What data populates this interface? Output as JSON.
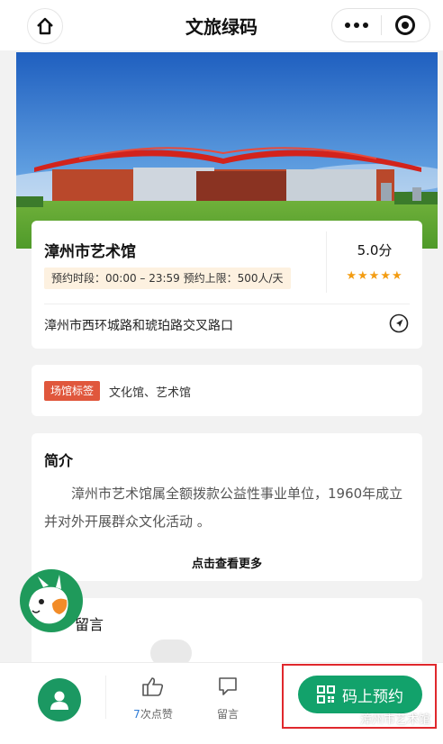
{
  "header": {
    "title": "文旅绿码"
  },
  "venue": {
    "name": "漳州市艺术馆",
    "hours": "预约时段：00:00 – 23:59 预约上限：500人/天",
    "score": "5.0分",
    "rating": 5,
    "stars": "★★★★★",
    "address": "漳州市西环城路和琥珀路交叉路口"
  },
  "tags": {
    "badge": "场馆标签",
    "text": "文化馆、艺术馆"
  },
  "intro": {
    "title": "简介",
    "body": "漳州市艺术馆属全额拨款公益性事业单位，1960年成立并对外开展群众文化活动 。",
    "more": "点击查看更多"
  },
  "comments": {
    "title": "留言"
  },
  "bottom_bar": {
    "like_count": "7",
    "like_suffix": "次点赞",
    "comment_label": "留言",
    "reserve_label": "码上预约"
  },
  "watermark": "漳州市艺术馆",
  "colors": {
    "brand_green": "#12a26b",
    "tag_red": "#e0573c",
    "star_orange": "#f39c12",
    "highlight_red": "#e0282d"
  }
}
